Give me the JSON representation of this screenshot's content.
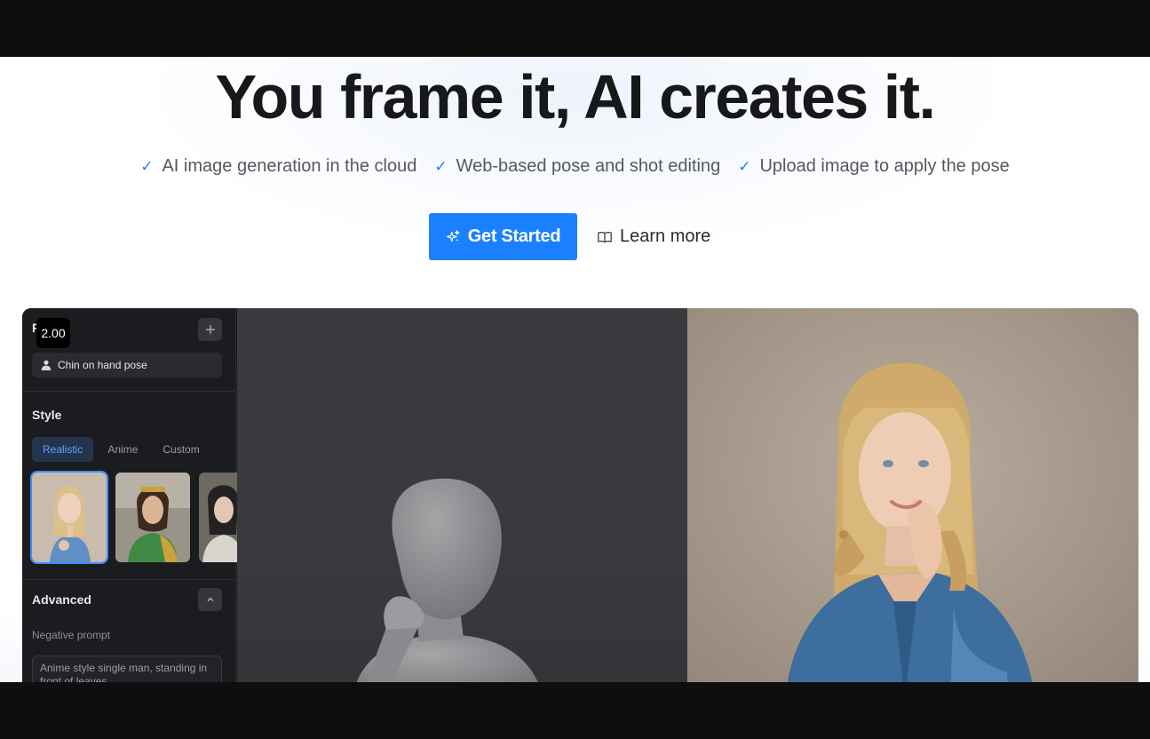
{
  "hero": {
    "headline": "You frame it, AI creates it.",
    "features": [
      "AI image generation in the cloud",
      "Web-based pose and shot editing",
      "Upload image to apply the pose"
    ],
    "check_glyph": "✓",
    "cta_label": "Get Started",
    "learn_label": "Learn more"
  },
  "app_preview": {
    "tooltip_value": "2.00",
    "side_heading_initial": "P",
    "pose_value": "Chin on hand pose",
    "style_title": "Style",
    "style_tabs": [
      {
        "label": "Realistic",
        "active": true
      },
      {
        "label": "Anime",
        "active": false
      },
      {
        "label": "Custom",
        "active": false
      }
    ],
    "advanced_title": "Advanced",
    "negative_prompt_label": "Negative prompt",
    "negative_prompt_value": "Anime style single man, standing in front of leaves"
  },
  "colors": {
    "accent": "#1a80ff",
    "headline": "#17181a",
    "app_bg": "#1b1c1f"
  },
  "icons": [
    "check-icon",
    "sparkles-icon",
    "book-icon",
    "plus-icon",
    "user-icon",
    "chevron-up-icon"
  ]
}
